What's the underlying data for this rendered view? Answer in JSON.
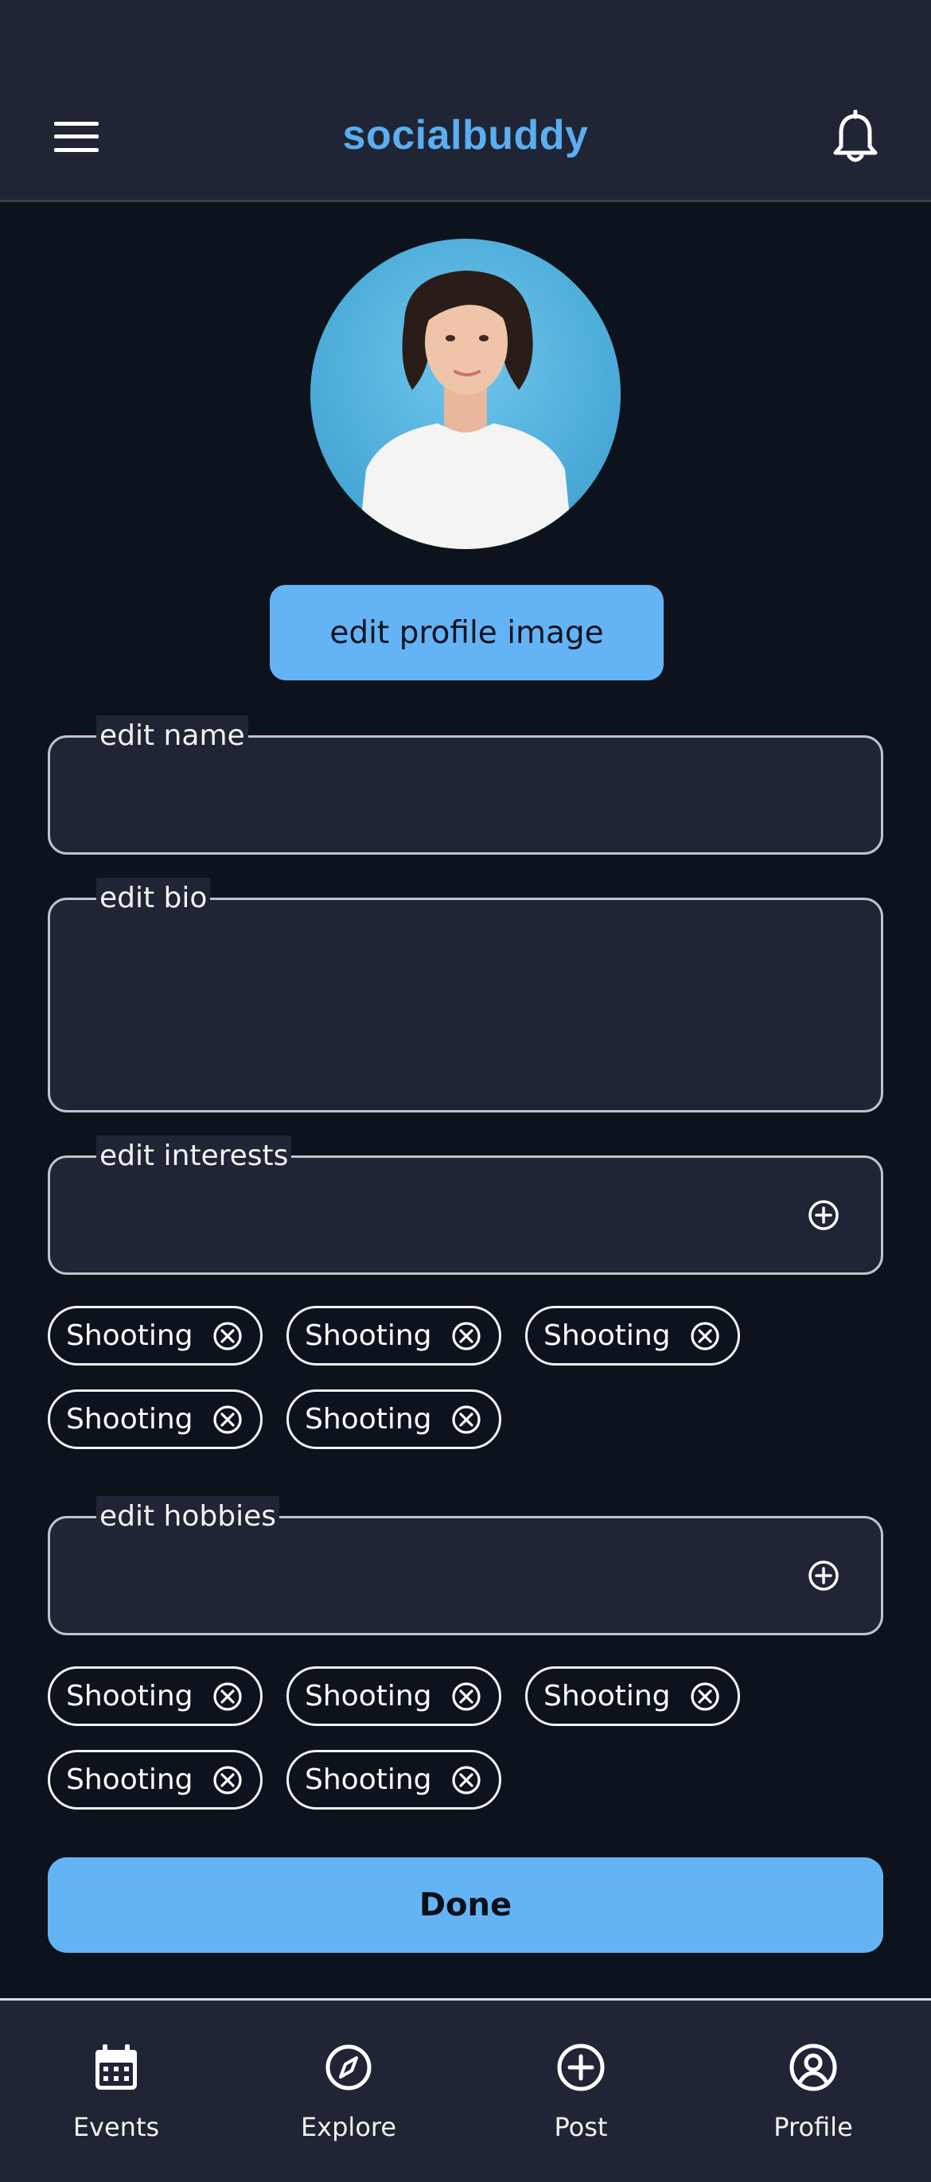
{
  "header": {
    "title": "socialbuddy",
    "menu_icon": "hamburger-menu-icon",
    "notification_icon": "bell-icon"
  },
  "profile": {
    "avatar_alt": "profile photo",
    "edit_image_label": "edit profile image"
  },
  "form": {
    "name": {
      "label": "edit name",
      "value": ""
    },
    "bio": {
      "label": "edit bio",
      "value": ""
    },
    "interests": {
      "label": "edit interests",
      "value": "",
      "chips": [
        "Shooting",
        "Shooting",
        "Shooting",
        "Shooting",
        "Shooting"
      ]
    },
    "hobbies": {
      "label": "edit hobbies",
      "value": "",
      "chips": [
        "Shooting",
        "Shooting",
        "Shooting",
        "Shooting",
        "Shooting"
      ]
    },
    "done_label": "Done"
  },
  "nav": {
    "items": [
      {
        "label": "Events",
        "icon": "calendar-icon"
      },
      {
        "label": "Explore",
        "icon": "compass-icon"
      },
      {
        "label": "Post",
        "icon": "add-circle-icon"
      },
      {
        "label": "Profile",
        "icon": "user-circle-icon"
      }
    ]
  },
  "colors": {
    "accent": "#64b4f5",
    "brand": "#5aaef1",
    "background": "#0d131d",
    "surface": "#1f2534"
  }
}
